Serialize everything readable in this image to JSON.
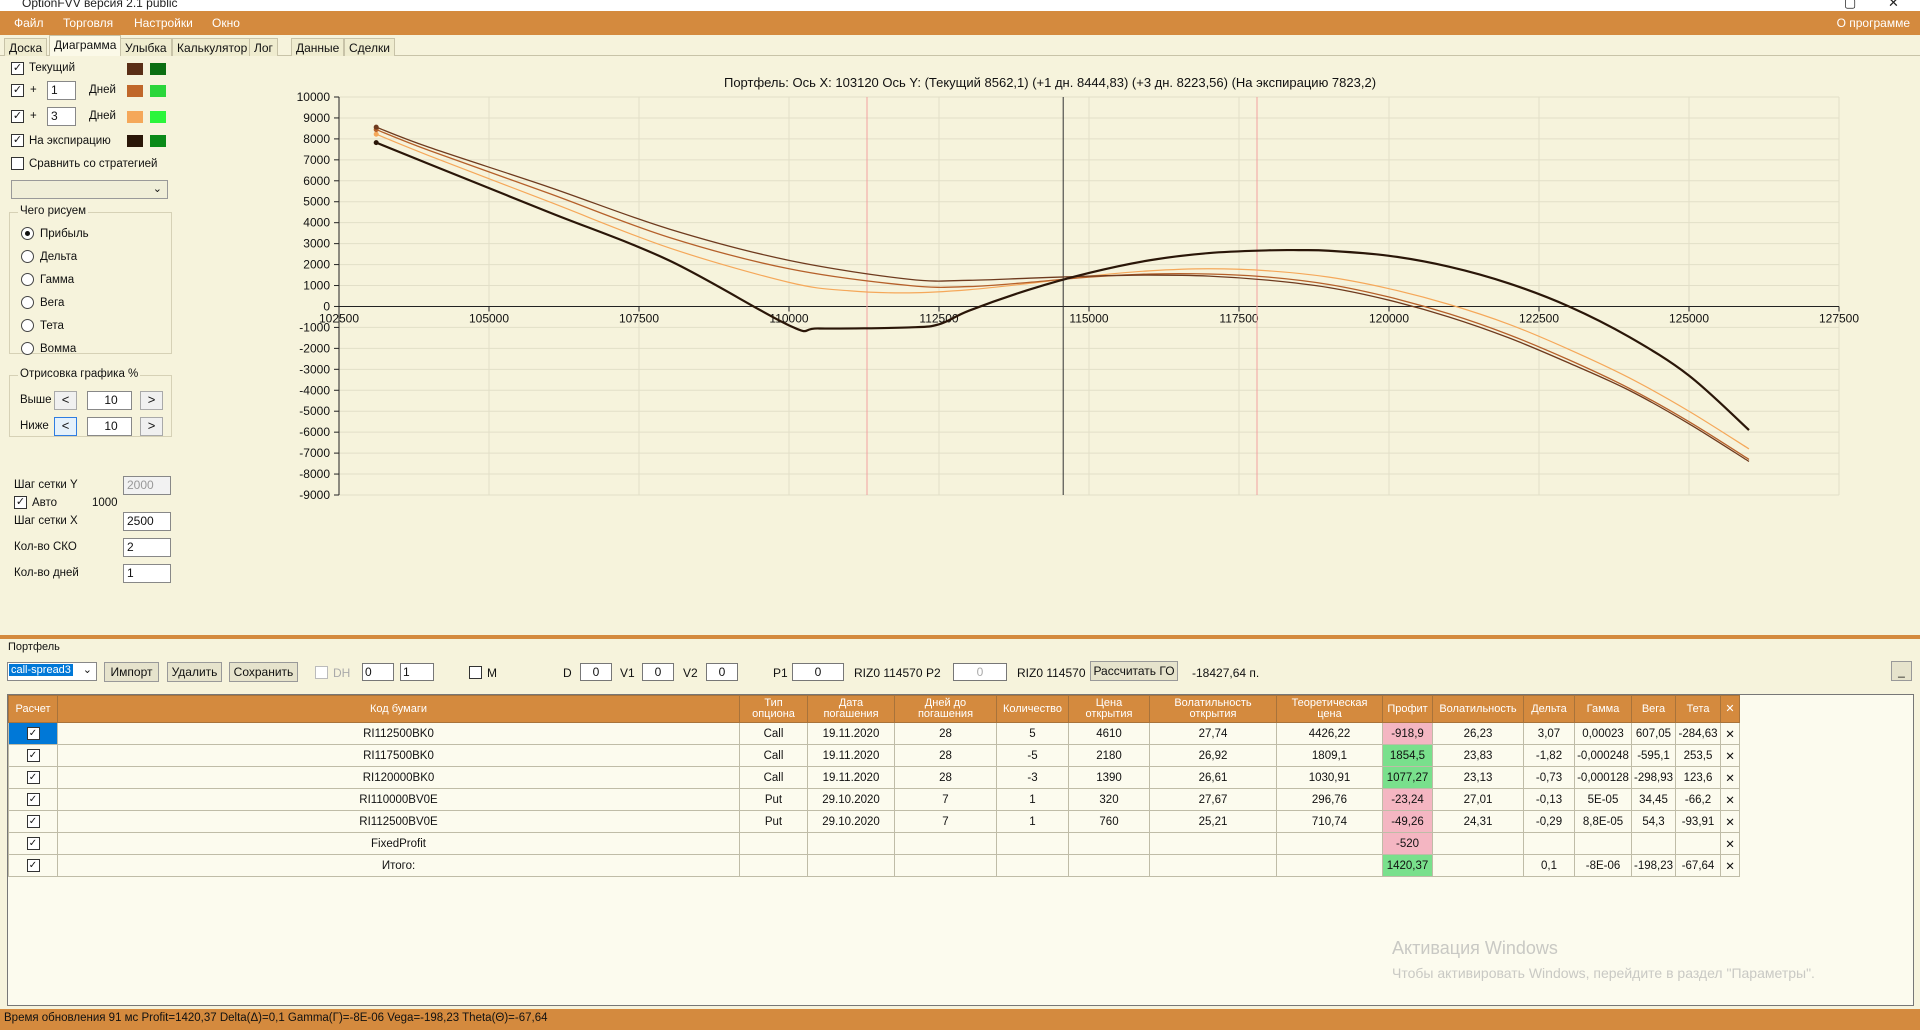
{
  "window": {
    "title": "OptionFVV версия 2.1 public",
    "minimize": "▢",
    "close": "✕"
  },
  "menu": {
    "items": [
      "Файл",
      "Торговля",
      "Настройки",
      "Окно"
    ],
    "about": "О программе"
  },
  "tabs": [
    "Доска",
    "Диаграмма",
    "Улыбка",
    "Калькулятор",
    "Лог",
    "Данные",
    "Сделки"
  ],
  "active_tab": "Диаграмма",
  "left": {
    "current": {
      "label": "Текущий",
      "checked": true,
      "colors": [
        "#5a2e16",
        "#0b6e12"
      ]
    },
    "plus1": {
      "label": "+",
      "value": "1",
      "unit": "Дней",
      "checked": true,
      "colors": [
        "#c0672a",
        "#2bd63b"
      ]
    },
    "plus3": {
      "label": "+",
      "value": "3",
      "unit": "Дней",
      "checked": true,
      "colors": [
        "#f5a85a",
        "#2bf53b"
      ]
    },
    "expiry": {
      "label": "На экспирацию",
      "checked": true,
      "colors": [
        "#2a1608",
        "#0a8a18"
      ]
    },
    "compare": {
      "label": "Сравнить со стратегией",
      "checked": false
    },
    "draw_group": {
      "title": "Чего рисуем",
      "options": [
        "Прибыль",
        "Дельта",
        "Гамма",
        "Вега",
        "Тета",
        "Вомма"
      ],
      "selected": "Прибыль"
    },
    "render_group": {
      "title": "Отрисовка графика %",
      "above_label": "Выше",
      "above_value": "10",
      "below_label": "Ниже",
      "below_value": "10",
      "left_arrow": "<",
      "right_arrow": ">"
    },
    "grid_y_label": "Шаг сетки Y",
    "grid_y_value": "2000",
    "auto_label": "Авто",
    "auto_value": "1000",
    "grid_x_label": "Шаг сетки X",
    "grid_x_value": "2500",
    "sko_label": "Кол-во СКО",
    "sko_value": "2",
    "days_label": "Кол-во дней",
    "days_value": "1"
  },
  "chart_data": {
    "type": "line",
    "title": "Портфель: Ось X: 103120 Ось Y:  (Текущий 8562,1)  (+1 дн. 8444,83)  (+3 дн. 8223,56)  (На экспирацию 7823,2)",
    "xlim": [
      102500,
      127500
    ],
    "ylim": [
      -9000,
      10000
    ],
    "xticks": [
      102500,
      105000,
      107500,
      110000,
      112500,
      115000,
      117500,
      120000,
      122500,
      125000,
      127500
    ],
    "yticks": [
      10000,
      9000,
      8000,
      7000,
      6000,
      5000,
      4000,
      3000,
      2000,
      1000,
      0,
      -1000,
      -2000,
      -3000,
      -4000,
      -5000,
      -6000,
      -7000,
      -8000,
      -9000
    ],
    "grid": true,
    "vlines": [
      {
        "x": 111300,
        "color": "#f2a0a0"
      },
      {
        "x": 114570,
        "color": "#333333"
      },
      {
        "x": 117800,
        "color": "#f2a0a0"
      }
    ],
    "series": [
      {
        "color": "#2a1608",
        "width": 2.2,
        "x": [
          103120,
          104000,
          106000,
          108000,
          110000,
          110500,
          112000,
          112500,
          113000,
          114000,
          115000,
          116000,
          117000,
          118000,
          118500,
          119000,
          120000,
          121000,
          122000,
          123000,
          124000,
          125000,
          126000
        ],
        "y": [
          7823,
          6800,
          4500,
          2200,
          -900,
          -1050,
          -1000,
          -850,
          -200,
          800,
          1600,
          2200,
          2550,
          2680,
          2690,
          2660,
          2420,
          1900,
          1100,
          0,
          -1450,
          -3300,
          -5900
        ]
      },
      {
        "color": "#6e3a1e",
        "width": 1.3,
        "x": [
          103120,
          104000,
          106000,
          108000,
          110000,
          112000,
          113000,
          114000,
          115000,
          116000,
          117000,
          118000,
          119000,
          120000,
          121000,
          122000,
          123000,
          124000,
          125000,
          126000
        ],
        "y": [
          8562,
          7600,
          5700,
          3700,
          2200,
          1300,
          1250,
          1350,
          1450,
          1500,
          1450,
          1250,
          900,
          300,
          -500,
          -1500,
          -2700,
          -4000,
          -5600,
          -7400
        ]
      },
      {
        "color": "#b5602a",
        "width": 1.3,
        "x": [
          103120,
          104000,
          106000,
          108000,
          110000,
          112000,
          113000,
          114000,
          115000,
          116000,
          117000,
          118000,
          119000,
          120000,
          121000,
          122000,
          123000,
          124000,
          125000,
          126000
        ],
        "y": [
          8445,
          7450,
          5400,
          3300,
          1800,
          1000,
          950,
          1150,
          1400,
          1550,
          1550,
          1400,
          1050,
          450,
          -350,
          -1350,
          -2550,
          -3900,
          -5500,
          -7300
        ]
      },
      {
        "color": "#f5a85a",
        "width": 1.2,
        "x": [
          103120,
          104000,
          106000,
          108000,
          110000,
          111000,
          112000,
          113000,
          114000,
          115000,
          116000,
          117000,
          118000,
          119000,
          120000,
          121000,
          122000,
          123000,
          124000,
          125000,
          126000
        ],
        "y": [
          8224,
          7200,
          5000,
          2800,
          1150,
          750,
          650,
          800,
          1100,
          1450,
          1700,
          1800,
          1700,
          1400,
          850,
          100,
          -850,
          -2050,
          -3400,
          -5000,
          -6800
        ]
      }
    ]
  },
  "portfolio": {
    "title": "Портфель",
    "strategy": "call-spread3",
    "import_btn": "Импорт",
    "delete_btn": "Удалить",
    "save_btn": "Сохранить",
    "dh_label": "DH",
    "spin1": "0",
    "spin2": "1",
    "m_label": "M",
    "d_label": "D",
    "d_value": "0",
    "v1_label": "V1",
    "v1_value": "0",
    "v2_label": "V2",
    "v2_value": "0",
    "p1_label": "P1",
    "p1_value": "0",
    "riz1": "RIZ0 114570",
    "p2_label": "P2",
    "p2_value": "0",
    "riz2": "RIZ0 114570",
    "calc_go": "Рассчитать ГО",
    "go_value": "-18427,64 п.",
    "min_btn": "_"
  },
  "table": {
    "headers": [
      "Расчет",
      "Код бумаги",
      "Тип опциона",
      "Дата погашения",
      "Дней до погашения",
      "Количество",
      "Цена открытия",
      "Волатильность открытия",
      "Теоретическая цена",
      "Профит",
      "Волатильность",
      "Дельта",
      "Гамма",
      "Вега",
      "Тета",
      "✕"
    ],
    "rows": [
      [
        "✓",
        "RI112500BK0",
        "Call",
        "19.11.2020",
        "28",
        "5",
        "4610",
        "27,74",
        "4426,22",
        "-918,9",
        "26,23",
        "3,07",
        "0,00023",
        "607,05",
        "-284,63",
        "✕"
      ],
      [
        "✓",
        "RI117500BK0",
        "Call",
        "19.11.2020",
        "28",
        "-5",
        "2180",
        "26,92",
        "1809,1",
        "1854,5",
        "23,83",
        "-1,82",
        "-0,000248",
        "-595,1",
        "253,5",
        "✕"
      ],
      [
        "✓",
        "RI120000BK0",
        "Call",
        "19.11.2020",
        "28",
        "-3",
        "1390",
        "26,61",
        "1030,91",
        "1077,27",
        "23,13",
        "-0,73",
        "-0,000128",
        "-298,93",
        "123,6",
        "✕"
      ],
      [
        "✓",
        "RI110000BV0E",
        "Put",
        "29.10.2020",
        "7",
        "1",
        "320",
        "27,67",
        "296,76",
        "-23,24",
        "27,01",
        "-0,13",
        "5E-05",
        "34,45",
        "-66,2",
        "✕"
      ],
      [
        "✓",
        "RI112500BV0E",
        "Put",
        "29.10.2020",
        "7",
        "1",
        "760",
        "25,21",
        "710,74",
        "-49,26",
        "24,31",
        "-0,29",
        "8,8E-05",
        "54,3",
        "-93,91",
        "✕"
      ],
      [
        "✓",
        "FixedProfit",
        "",
        "",
        "",
        "",
        "",
        "",
        "",
        "-520",
        "",
        "",
        "",
        "",
        "",
        "✕"
      ],
      [
        "✓",
        "Итого:",
        "",
        "",
        "",
        "",
        "",
        "",
        "",
        "1420,37",
        "",
        "0,1",
        "-8E-06",
        "-198,23",
        "-67,64",
        "✕"
      ]
    ],
    "profit_colors": [
      "pink",
      "green",
      "green",
      "pink",
      "pink",
      "pink",
      "green"
    ]
  },
  "watermark": {
    "line1": "Активация Windows",
    "line2": "Чтобы активировать Windows, перейдите в раздел \"Параметры\"."
  },
  "status": "Время обновления 91 мс  Profit=1420,37 Delta(Δ)=0,1 Gamma(Γ)=-8E-06 Vega=-198,23 Theta(Θ)=-67,64"
}
